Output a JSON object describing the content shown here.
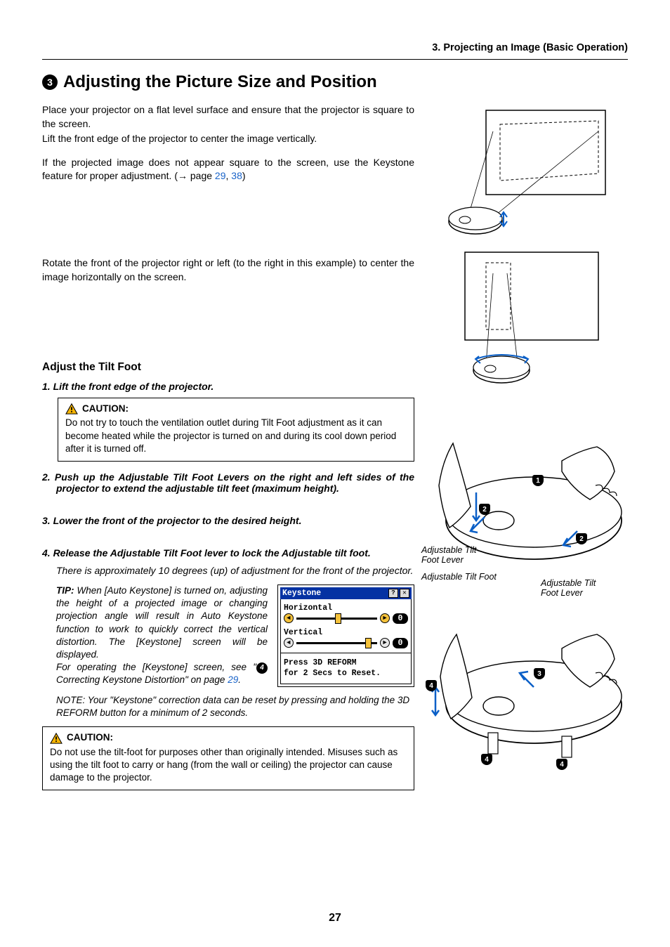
{
  "header": {
    "breadcrumb": "3. Projecting an Image (Basic Operation)"
  },
  "section": {
    "number": "3",
    "title": "Adjusting the Picture Size and Position"
  },
  "intro": {
    "p1": "Place your projector on a flat level surface and ensure that the projector is square to the screen.",
    "p2": "Lift the front edge of the projector to center the image vertically.",
    "p3a": "If the projected image does not appear square to the screen, use the Keystone feature for proper adjustment. (→ page ",
    "link1": "29",
    "comma": ", ",
    "link2": "38",
    "p3b": ")",
    "p4": "Rotate the front of the projector right or left (to the right in this example) to center the image horizontally on the screen."
  },
  "tilt": {
    "heading": "Adjust the Tilt Foot",
    "s1": "1. Lift the front edge of the projector.",
    "c1_head": "CAUTION:",
    "c1_body": "Do not try to touch the ventilation outlet during Tilt Foot adjustment as it can become heated while the projector is turned on and during its cool down period after it is turned off.",
    "s2": "2. Push up the Adjustable Tilt Foot Levers on the right and left sides of the projector to extend the adjustable tilt feet (maximum height).",
    "s3": "3. Lower the front of the projector to the desired height.",
    "s4": "4. Release the Adjustable Tilt Foot lever to lock the Adjustable tilt foot.",
    "s4b": "There is approximately 10 degrees (up) of adjustment for the front of the projector.",
    "tip_lead": "TIP:",
    "tip_a": " When [Auto Keystone] is turned on, adjusting the height of a projected image or changing projection angle will result in Auto Keystone function to work to quickly correct the vertical distortion. The [Keystone] screen will be displayed.",
    "tip_b1": "For operating the [Keystone] screen, see \"",
    "tip_num": "4",
    "tip_b2": " Correcting Keystone Distortion\" on page ",
    "tip_link": "29",
    "tip_b3": ".",
    "note": "NOTE: Your \"Keystone\" correction data can be reset by pressing and holding the 3D REFORM button for a minimum of 2 seconds.",
    "c2_head": "CAUTION:",
    "c2_body": "Do not use the tilt-foot for purposes other than originally intended. Misuses such as using the tilt foot to carry or hang (from the wall or ceiling) the projector can cause damage to the projector."
  },
  "keystone": {
    "title": "Keystone",
    "h_label": "Horizontal",
    "h_value": "0",
    "v_label": "Vertical",
    "v_value": "0",
    "reset1": "Press 3D REFORM",
    "reset2": "for 2 Secs to Reset."
  },
  "diagram": {
    "lever1": "Adjustable Tilt Foot Lever",
    "foot": "Adjustable Tilt Foot",
    "lever2": "Adjustable Tilt Foot Lever",
    "n1": "1",
    "n2": "2",
    "n3": "3",
    "n4": "4"
  },
  "page_number": "27"
}
